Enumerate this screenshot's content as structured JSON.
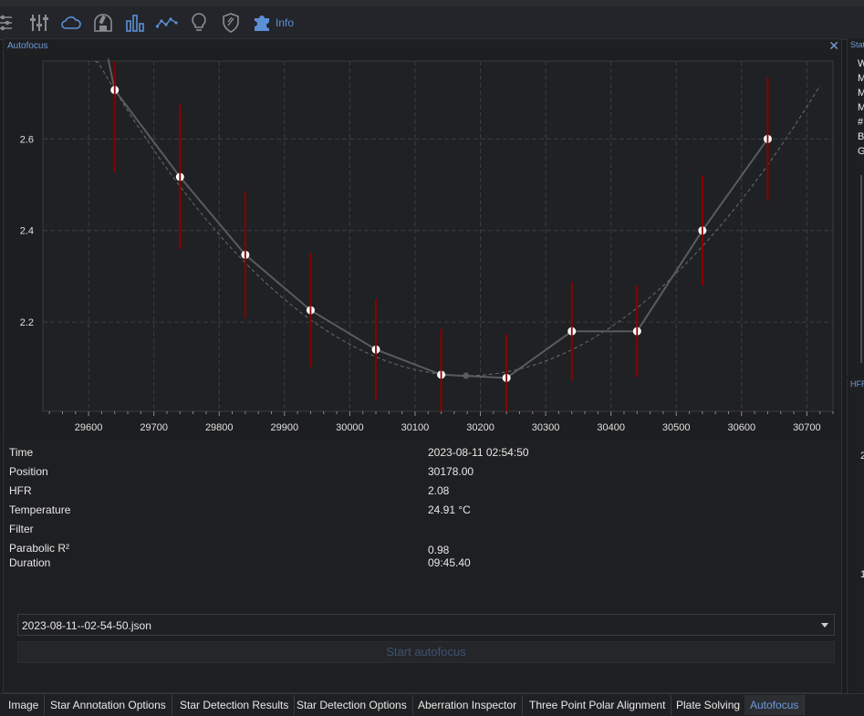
{
  "toolbar": {
    "icons": [
      "equipment-icon",
      "sliders-icon",
      "cloud-icon",
      "observatory-icon",
      "bar-chart-icon",
      "line-chart-icon",
      "lightbulb-icon",
      "shield-icon",
      "puzzle-icon"
    ],
    "info_label": "Info",
    "accent": "#5b8fd6"
  },
  "panel": {
    "title": "Autofocus",
    "close_glyph": "✕"
  },
  "chart_data": {
    "type": "scatter",
    "xlim": [
      29530,
      30740
    ],
    "ylim": [
      2.005,
      2.77
    ],
    "xticks": [
      29600,
      29700,
      29800,
      29900,
      30000,
      30100,
      30200,
      30300,
      30400,
      30500,
      30600,
      30700
    ],
    "yticks": [
      2.2,
      2.4,
      2.6
    ],
    "ytick_labels": [
      "2.2",
      "2.4",
      "2.6"
    ],
    "series": [
      {
        "x": [
          29640,
          29740,
          29840,
          29940,
          30040,
          30140,
          30240,
          30340,
          30440,
          30540,
          30640
        ],
        "y": [
          2.707,
          2.517,
          2.347,
          2.226,
          2.14,
          2.085,
          2.078,
          2.18,
          2.18,
          2.4,
          2.6
        ],
        "err": [
          0.18,
          0.158,
          0.138,
          0.125,
          0.11,
          0.1,
          0.095,
          0.108,
          0.1,
          0.12,
          0.135
        ]
      }
    ],
    "fit_minimum": {
      "x": 30178,
      "y": 2.083
    },
    "grid": true
  },
  "info": {
    "rows": [
      {
        "label": "Time",
        "value": "2023-08-11 02:54:50"
      },
      {
        "label": "Position",
        "value": "30178.00"
      },
      {
        "label": "HFR",
        "value": "2.08"
      },
      {
        "label": "Temperature",
        "value": "24.91 °C"
      },
      {
        "label": "Filter",
        "value": ""
      },
      {
        "label": "Parabolic R²",
        "value": "0.98"
      },
      {
        "label": "Duration",
        "value": "09:45.40"
      }
    ]
  },
  "file_select": {
    "value": "2023-08-11--02-54-50.json"
  },
  "start_button": {
    "label": "Start autofocus"
  },
  "tabs": [
    {
      "label": "Image",
      "active": false
    },
    {
      "label": "Star Annotation Options",
      "active": false
    },
    {
      "label": "Star Detection Results",
      "active": false
    },
    {
      "label": "Star Detection Options",
      "active": false
    },
    {
      "label": "Aberration Inspector",
      "active": false
    },
    {
      "label": "Three Point Polar Alignment",
      "active": false
    },
    {
      "label": "Plate Solving",
      "active": false
    },
    {
      "label": "Autofocus",
      "active": true
    }
  ],
  "right_panel": {
    "title": "Stat",
    "lines": [
      "W",
      "M",
      "M",
      "M",
      "#",
      "B",
      "G"
    ],
    "lower_title": "HFR",
    "lower_axis": [
      "2",
      "1"
    ]
  }
}
